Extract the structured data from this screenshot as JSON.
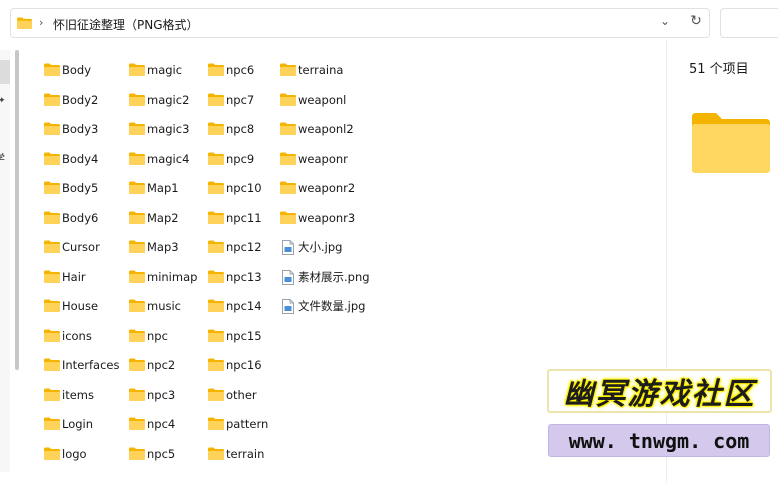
{
  "address": {
    "path": "怀旧征途整理（PNG格式）",
    "chevron": "›",
    "dropdown": "⌄",
    "refresh": "↻"
  },
  "nav": {
    "pin": "✦",
    "partial_text": "学"
  },
  "details": {
    "item_count": "51 个项目"
  },
  "files": [
    {
      "name": "Body",
      "type": "folder"
    },
    {
      "name": "Body2",
      "type": "folder"
    },
    {
      "name": "Body3",
      "type": "folder"
    },
    {
      "name": "Body4",
      "type": "folder"
    },
    {
      "name": "Body5",
      "type": "folder"
    },
    {
      "name": "Body6",
      "type": "folder"
    },
    {
      "name": "Cursor",
      "type": "folder"
    },
    {
      "name": "Hair",
      "type": "folder"
    },
    {
      "name": "House",
      "type": "folder"
    },
    {
      "name": "icons",
      "type": "folder"
    },
    {
      "name": "Interfaces",
      "type": "folder"
    },
    {
      "name": "items",
      "type": "folder"
    },
    {
      "name": "Login",
      "type": "folder"
    },
    {
      "name": "logo",
      "type": "folder"
    },
    {
      "name": "magic",
      "type": "folder"
    },
    {
      "name": "magic2",
      "type": "folder"
    },
    {
      "name": "magic3",
      "type": "folder"
    },
    {
      "name": "magic4",
      "type": "folder"
    },
    {
      "name": "Map1",
      "type": "folder"
    },
    {
      "name": "Map2",
      "type": "folder"
    },
    {
      "name": "Map3",
      "type": "folder"
    },
    {
      "name": "minimap",
      "type": "folder"
    },
    {
      "name": "music",
      "type": "folder"
    },
    {
      "name": "npc",
      "type": "folder"
    },
    {
      "name": "npc2",
      "type": "folder"
    },
    {
      "name": "npc3",
      "type": "folder"
    },
    {
      "name": "npc4",
      "type": "folder"
    },
    {
      "name": "npc5",
      "type": "folder"
    },
    {
      "name": "npc6",
      "type": "folder"
    },
    {
      "name": "npc7",
      "type": "folder"
    },
    {
      "name": "npc8",
      "type": "folder"
    },
    {
      "name": "npc9",
      "type": "folder"
    },
    {
      "name": "npc10",
      "type": "folder"
    },
    {
      "name": "npc11",
      "type": "folder"
    },
    {
      "name": "npc12",
      "type": "folder"
    },
    {
      "name": "npc13",
      "type": "folder"
    },
    {
      "name": "npc14",
      "type": "folder"
    },
    {
      "name": "npc15",
      "type": "folder"
    },
    {
      "name": "npc16",
      "type": "folder"
    },
    {
      "name": "other",
      "type": "folder"
    },
    {
      "name": "pattern",
      "type": "folder"
    },
    {
      "name": "terrain",
      "type": "folder"
    },
    {
      "name": "terraina",
      "type": "folder"
    },
    {
      "name": "weaponl",
      "type": "folder"
    },
    {
      "name": "weaponl2",
      "type": "folder"
    },
    {
      "name": "weaponr",
      "type": "folder"
    },
    {
      "name": "weaponr2",
      "type": "folder"
    },
    {
      "name": "weaponr3",
      "type": "folder"
    },
    {
      "name": "大小.jpg",
      "type": "image"
    },
    {
      "name": "素材展示.png",
      "type": "image"
    },
    {
      "name": "文件数量.jpg",
      "type": "image"
    }
  ],
  "watermark": {
    "title": "幽冥游戏社区",
    "url": "www. tnwgm. com"
  },
  "colors": {
    "folder_front": "#ffd35a",
    "folder_back": "#f5b400",
    "watermark_glow": "#fff200",
    "watermark_url_bg": "#d4c8ec"
  }
}
